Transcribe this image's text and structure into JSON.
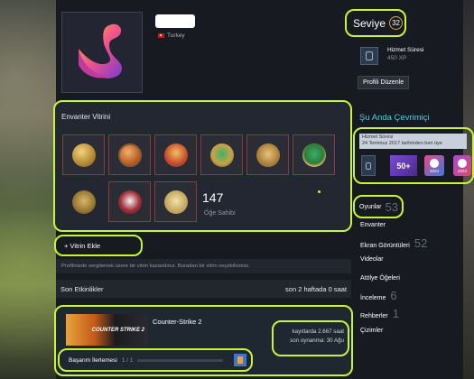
{
  "profile": {
    "country": "Turkey"
  },
  "level": {
    "label": "Seviye",
    "value": "32"
  },
  "badge": {
    "name": "Hizmet Süresi",
    "xp": "450 XP"
  },
  "edit_profile": "Profili Düzenle",
  "showcase": {
    "title": "Envanter Vitrini",
    "count": "147",
    "count_label": "Öğe Sahibi",
    "items": [
      {
        "icon": "pin-gold-icon"
      },
      {
        "icon": "pin-five-icon"
      },
      {
        "icon": "pin-red-star-icon"
      },
      {
        "icon": "pin-green-star-icon"
      },
      {
        "icon": "pin-eagle-icon"
      },
      {
        "icon": "pin-green-gem-icon"
      },
      {
        "icon": "pin-gold-eagle-icon"
      },
      {
        "icon": "pin-red-white-icon"
      },
      {
        "icon": "pin-cream-icon"
      }
    ]
  },
  "add_showcase": "+ Vitrin Ekle",
  "add_hint": "Profilinizde sergilemek üzere bir vitrin kazandınız. Buradan bir vitrin seçebilirsiniz.",
  "activity": {
    "title": "Son Etkinlikler",
    "summary": "son 2 haftada 0 saat",
    "game": {
      "cover_text": "COUNTER STRIKE 2",
      "name": "Counter-Strike 2",
      "total": "kayıtlarda 2.667 saat",
      "last": "son oynanma: 30 Ağu",
      "ach_label": "Başarım İlerlemesi",
      "ach_count": "1 / 1"
    }
  },
  "online": {
    "title": "Şu Anda Çevrimiçi",
    "tip_line1": "Hizmet Süresi",
    "tip_line2": "24 Temmuz 2017 tarihinden beri üye",
    "badge_50": "50+",
    "year1": "2024",
    "year2": "2022"
  },
  "nav": {
    "games": {
      "label": "Oyunlar",
      "count": "53"
    },
    "inventory": {
      "label": "Envanter"
    },
    "screenshots": {
      "label": "Ekran Görüntüleri",
      "count": "52"
    },
    "videos": {
      "label": "Videolar"
    },
    "workshop": {
      "label": "Atölye Öğeleri"
    },
    "reviews": {
      "label": "İnceleme",
      "count": "6"
    },
    "guides": {
      "label": "Rehberler",
      "count": "1"
    },
    "artwork": {
      "label": "Çizimler"
    }
  },
  "colors": {
    "highlight": "#c8f53a",
    "online": "#57cbde",
    "background": "#171a21"
  }
}
